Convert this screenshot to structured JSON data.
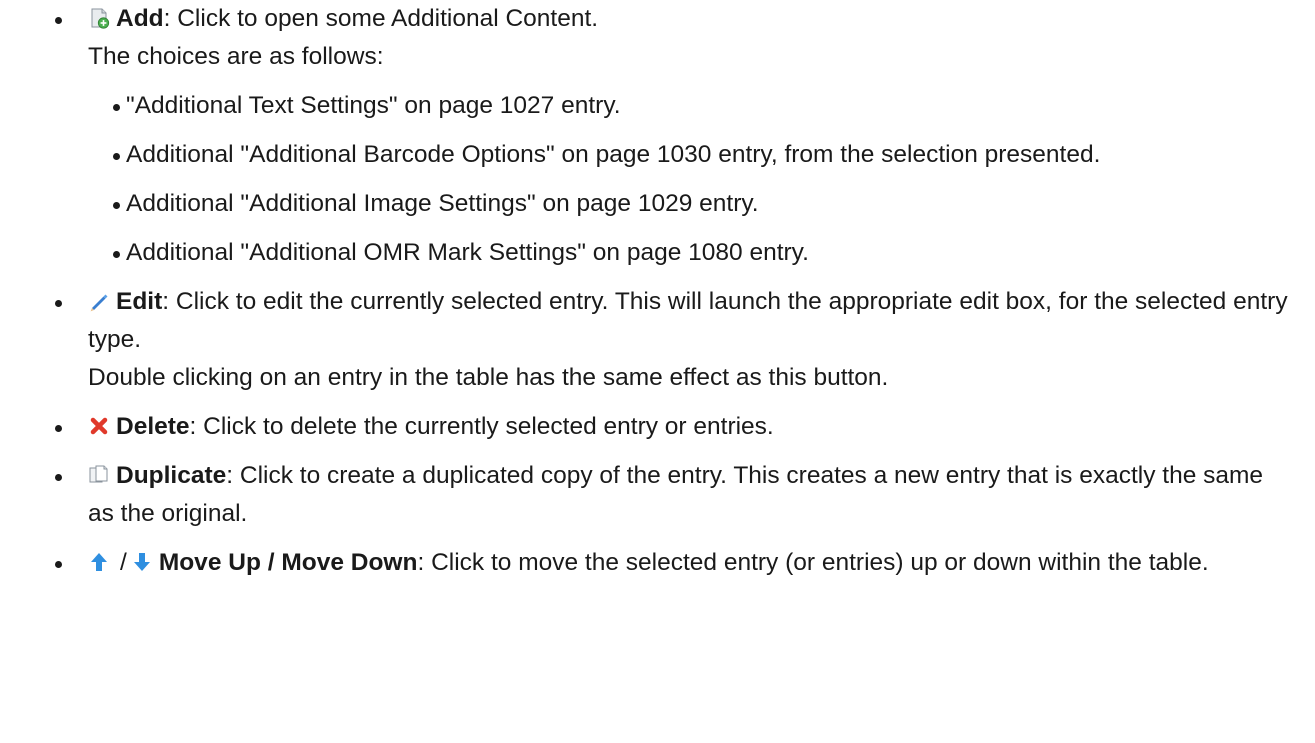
{
  "items": [
    {
      "icon": "add-content-icon",
      "label": "Add",
      "desc": ": Click to open some Additional Content.",
      "extra": "The choices are as follows:",
      "subitems": [
        "\"Additional Text Settings\" on page 1027 entry.",
        "Additional \"Additional Barcode Options\" on page 1030 entry, from the selection presented.",
        "Additional \"Additional Image Settings\" on page 1029 entry.",
        "Additional \"Additional OMR Mark Settings\" on page 1080 entry."
      ]
    },
    {
      "icon": "pencil-icon",
      "label": "Edit",
      "desc": ": Click to edit the currently selected entry. This will launch the appropriate edit box, for the selected entry type.",
      "extra": "Double clicking on an entry in the table has the same effect as this button."
    },
    {
      "icon": "delete-x-icon",
      "label": "Delete",
      "desc": ": Click to delete the currently selected entry or entries."
    },
    {
      "icon": "duplicate-icon",
      "label": "Duplicate",
      "desc": ": Click to create a duplicated copy of the entry. This creates a new entry that is exactly the same as the original."
    },
    {
      "icon_up": "arrow-up-icon",
      "separator": "/",
      "icon_down": "arrow-down-icon",
      "label": "Move Up / Move Down",
      "desc": ": Click to move the selected entry (or entries) up or down within the table."
    }
  ],
  "colors": {
    "text": "#1a1a1a",
    "delete_red": "#e0392b",
    "arrow_blue": "#2f8fe0",
    "pencil_blue": "#3a7fd0"
  }
}
